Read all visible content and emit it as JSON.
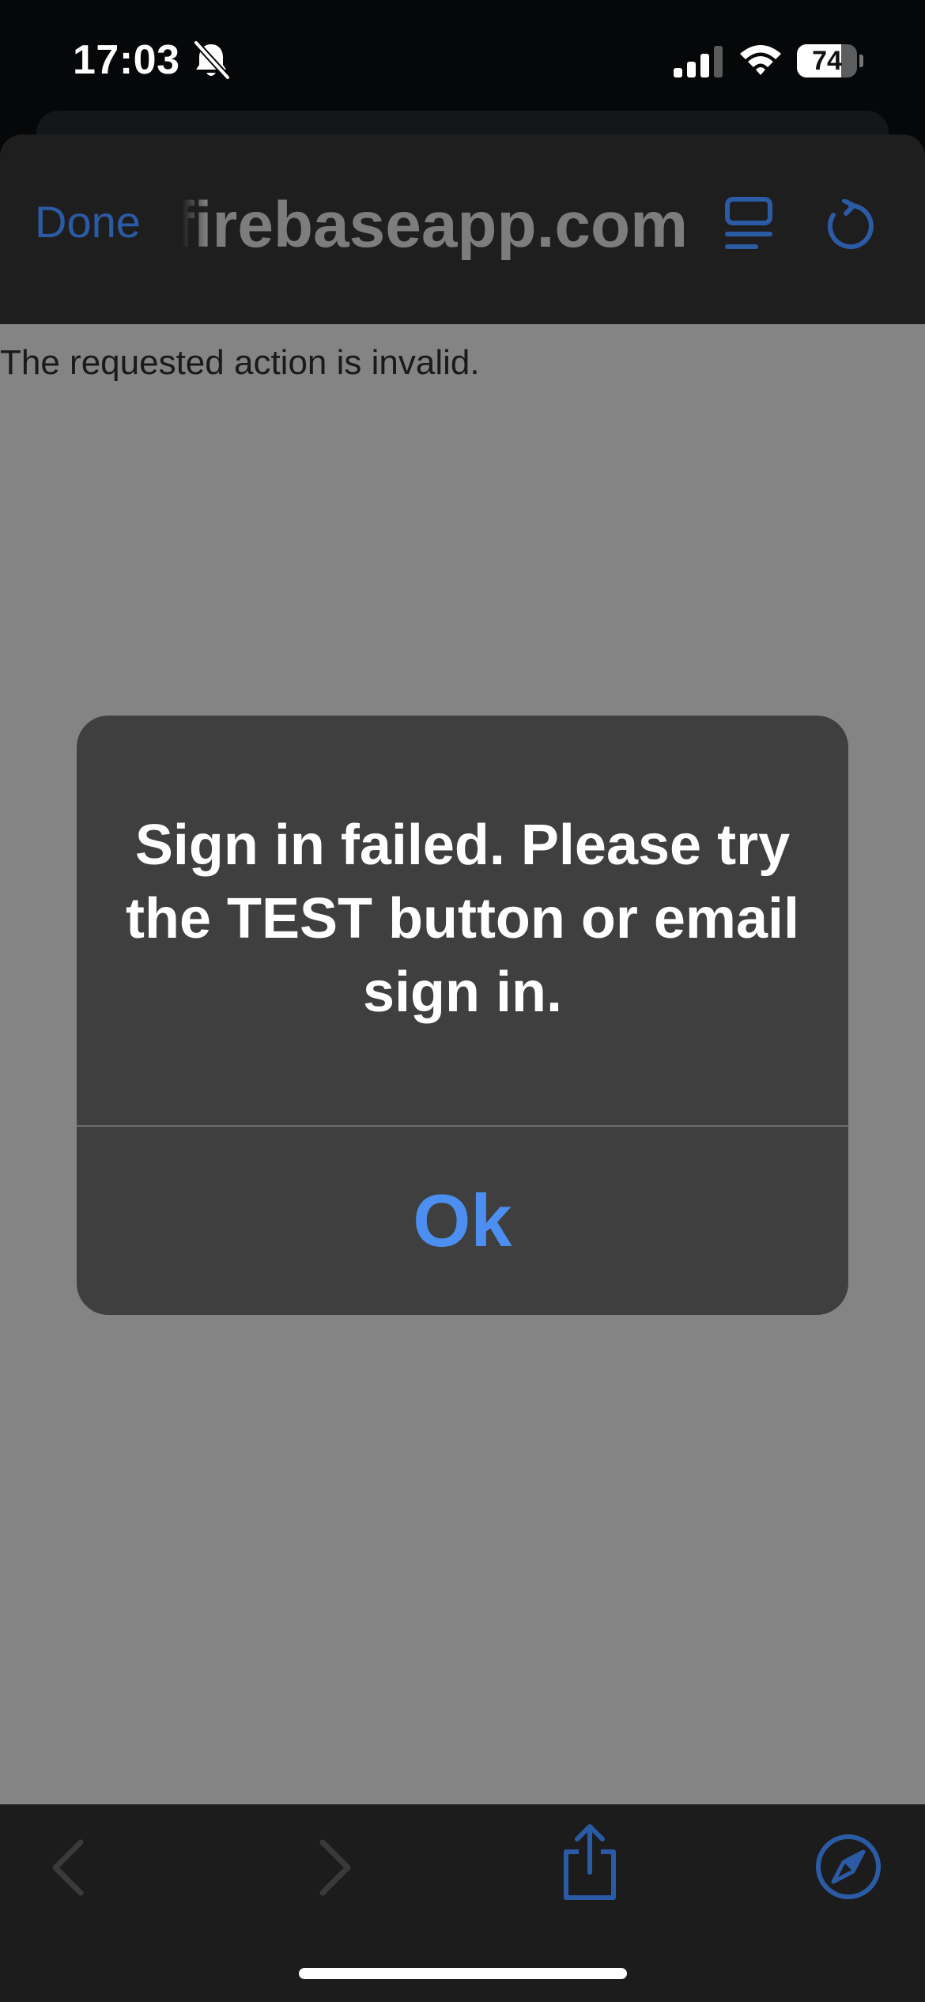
{
  "status_bar": {
    "time": "17:03",
    "battery_level": "74",
    "battery_fraction": 0.74
  },
  "toolbar": {
    "done_label": "Done",
    "url": "firebaseapp.com"
  },
  "page": {
    "message": "The requested action is invalid."
  },
  "alert": {
    "message": "Sign in failed. Please try the TEST button or email sign in.",
    "ok_label": "Ok"
  },
  "icons": {
    "status": [
      "bell-slash-icon",
      "cellular-signal-icon",
      "wifi-icon",
      "battery-icon"
    ],
    "toolbar": [
      "reader-view-icon",
      "reload-icon"
    ],
    "bottom": [
      "back-chevron-icon",
      "forward-chevron-icon",
      "share-icon",
      "safari-compass-icon"
    ]
  },
  "colors": {
    "accent_blue": "#4c8ff0",
    "dim_blue": "#2c5ba6",
    "alert_bg": "#3f3f3f",
    "content_bg": "#848484"
  }
}
